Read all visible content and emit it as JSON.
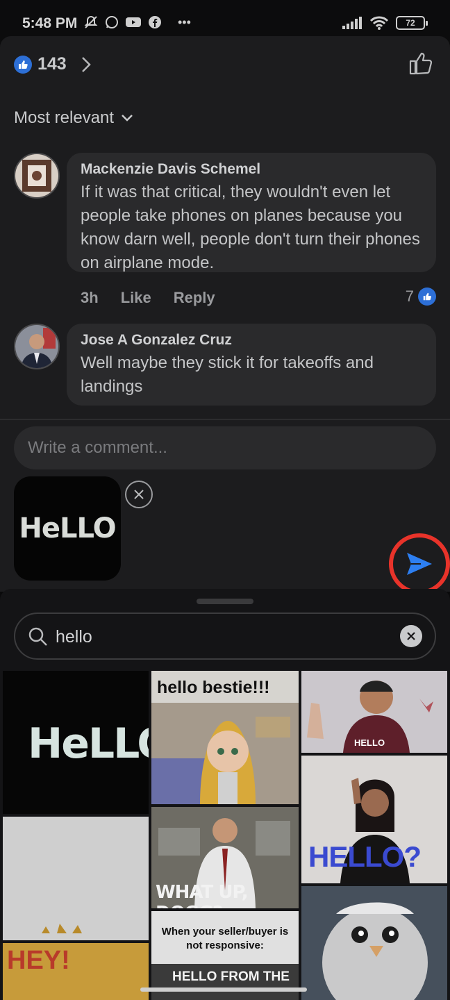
{
  "status_bar": {
    "time": "5:48 PM",
    "battery": "72",
    "more": "•••"
  },
  "reactions": {
    "count": "143"
  },
  "sort": {
    "label": "Most relevant"
  },
  "comments": [
    {
      "author": "Mackenzie Davis Schemel",
      "text": "If it was that critical, they wouldn't even let people take phones on planes because you know darn well, people don't turn their phones on airplane mode.",
      "time": "3h",
      "like_label": "Like",
      "reply_label": "Reply",
      "reactions": "7"
    },
    {
      "author": "Jose A Gonzalez Cruz",
      "text": "Well maybe they stick it for takeoffs and landings"
    }
  ],
  "composer": {
    "placeholder": "Write a comment...",
    "gif_preview_text": "HeLLO"
  },
  "gif_search": {
    "query": "hello",
    "results": [
      {
        "caption": "HeLLO"
      },
      {
        "caption": "hello bestie!!!"
      },
      {
        "caption": "HELLO"
      },
      {
        "caption": "HELLO?"
      },
      {
        "caption": "WHAT UP, DOGG?"
      },
      {
        "caption": "When your seller/buyer is not responsive:"
      },
      {
        "caption": "HELLO FROM THE"
      },
      {
        "caption": "HEY!"
      }
    ]
  },
  "colors": {
    "accent_blue": "#2d6fd6",
    "send_highlight": "#e8332a",
    "panel_bg": "#1c1c1e"
  }
}
